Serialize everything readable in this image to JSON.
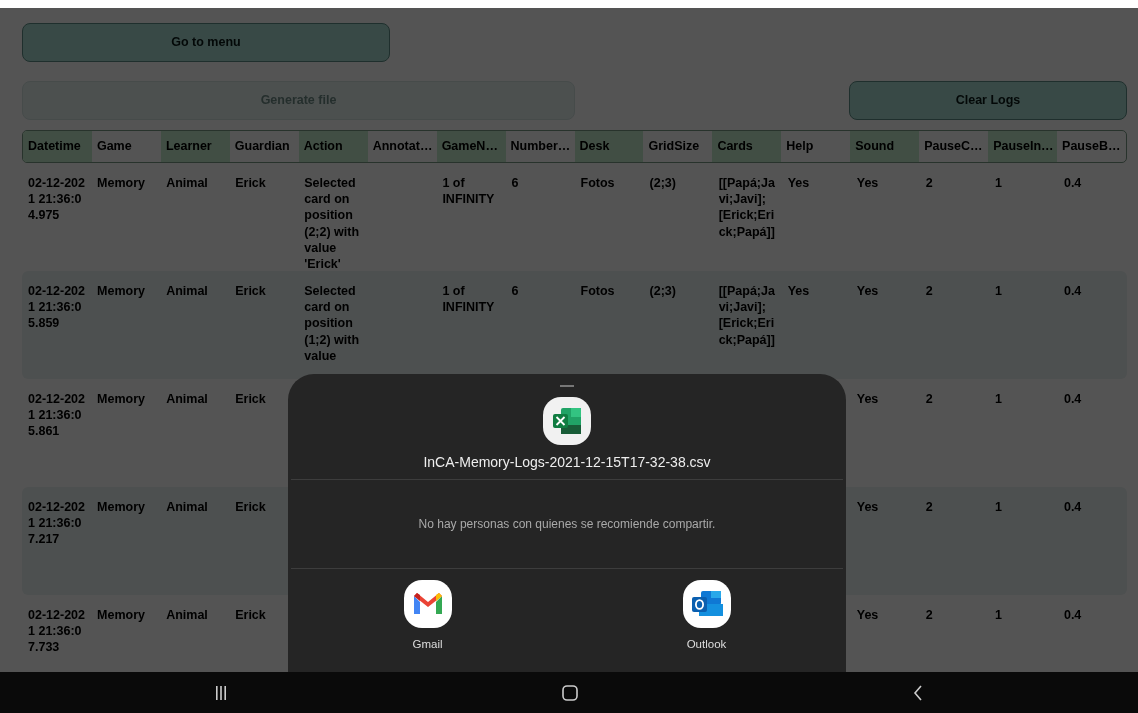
{
  "menu_button": {
    "label": "Go to menu",
    "disabled": false
  },
  "actions": [
    {
      "label": "Generate file",
      "disabled": true
    },
    {
      "label": "Clear Logs",
      "disabled": false
    }
  ],
  "table": {
    "columns": [
      "Datetime",
      "Game",
      "Learner",
      "Guardian",
      "Action",
      "Annotat…",
      "GameN…",
      "Number…",
      "Desk",
      "GridSize",
      "Cards",
      "Help",
      "Sound",
      "PauseC…",
      "PauseIn…",
      "PauseB…"
    ],
    "rows": [
      {
        "cells": [
          "02-12-2021 21:36:04.975",
          "Memory",
          "Animal",
          "Erick",
          "Selected card on position (2;2) with value 'Erick'",
          null,
          "1 of INFINITY",
          "6",
          "Fotos",
          "(2;3)",
          "[[Papá;Javi;Javi];[Erick;Erick;Papá]]",
          "Yes",
          "Yes",
          "2",
          "1",
          "0.4"
        ]
      },
      {
        "cells": [
          "02-12-2021 21:36:05.859",
          "Memory",
          "Animal",
          "Erick",
          "Selected card on position (1;2) with value",
          null,
          "1 of INFINITY",
          "6",
          "Fotos",
          "(2;3)",
          "[[Papá;Javi;Javi];[Erick;Erick;Papá]]",
          "Yes",
          "Yes",
          "2",
          "1",
          "0.4"
        ]
      },
      {
        "cells": [
          "02-12-2021 21:36:05.861",
          "Memory",
          "Animal",
          "Erick",
          null,
          null,
          null,
          null,
          null,
          null,
          null,
          null,
          "Yes",
          "2",
          "1",
          "0.4"
        ]
      },
      {
        "cells": [
          "02-12-2021 21:36:07.217",
          "Memory",
          "Animal",
          "Erick",
          null,
          null,
          null,
          null,
          null,
          null,
          null,
          null,
          "Yes",
          "2",
          "1",
          "0.4"
        ]
      },
      {
        "cells": [
          "02-12-2021 21:36:07.733",
          "Memory",
          "Animal",
          "Erick",
          null,
          null,
          null,
          null,
          null,
          null,
          null,
          null,
          "Yes",
          "2",
          "1",
          "0.4"
        ]
      }
    ]
  },
  "share_sheet": {
    "file_name": "InCA-Memory-Logs-2021-12-15T17-32-38.csv",
    "message": "No hay personas con quienes se recomiende compartir.",
    "apps": [
      {
        "name": "Gmail",
        "kind": "gmail"
      },
      {
        "name": "Outlook",
        "kind": "outlook"
      }
    ]
  }
}
